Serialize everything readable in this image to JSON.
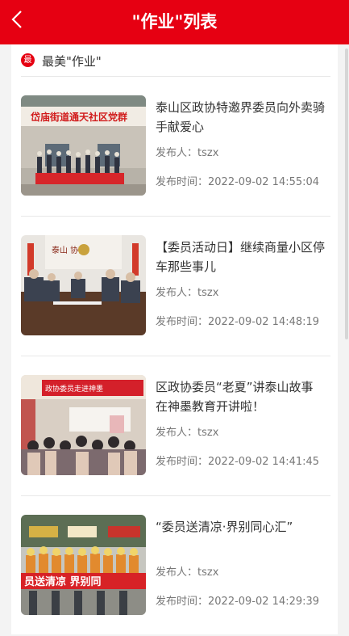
{
  "header": {
    "title": "\"作业\"列表"
  },
  "section": {
    "icon_text": "最",
    "title": "最美\"作业\""
  },
  "items": [
    {
      "title": "泰山区政协特邀界委员向外卖骑手献爱心",
      "publisher": "发布人：tszx",
      "time": "发布时间：2022-09-02 14:55:04",
      "photo_banner": "岱庙街道通天社区党群"
    },
    {
      "title": "【委员活动日】继续商量小区停车那些事儿",
      "publisher": "发布人：tszx",
      "time": "发布时间：2022-09-02 14:48:19",
      "photo_banner": "泰山 协商"
    },
    {
      "title": "区政协委员“老夏”讲泰山故事在神墨教育开讲啦！",
      "publisher": "发布人：tszx",
      "time": "发布时间：2022-09-02 14:41:45",
      "photo_banner": "政协委员走进神墨"
    },
    {
      "title": "“委员送清凉·界别同心汇”",
      "publisher": "发布人：tszx",
      "time": "发布时间：2022-09-02 14:29:39",
      "photo_banner": "员送清凉 界别同"
    }
  ],
  "colors": {
    "brand_red": "#e60012"
  }
}
